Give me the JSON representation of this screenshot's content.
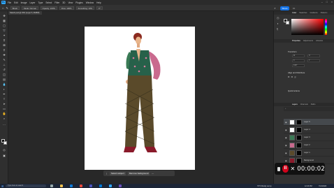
{
  "menubar": {
    "logo": "Ps",
    "items": [
      "File",
      "Edit",
      "Image",
      "Layer",
      "Type",
      "Select",
      "Filter",
      "3D",
      "View",
      "Plugins",
      "Window",
      "Help"
    ]
  },
  "options": {
    "brush_label": "Brush",
    "mode_label": "Mode: Normal",
    "opacity_label": "Opacity: 100%",
    "flow_label": "Flow: 100%",
    "smoothing_label": "Smoothing: 10%",
    "angle_value": "0°",
    "share_label": "Share"
  },
  "document": {
    "tab_title": "Sketch.psd @ 33% (Layer 5, RGB/8)"
  },
  "context_bar": {
    "select_subject": "Select subject",
    "remove_background": "Remove background"
  },
  "panels": {
    "color_tabs": [
      "Color",
      "Swatches",
      "Gradients",
      "Patterns"
    ],
    "properties_tabs": [
      "Properties",
      "Adjustments",
      "Libraries"
    ],
    "transform_title": "Transform",
    "align_title": "Align and Distribute",
    "quick_actions_title": "Quick Actions",
    "layers_tabs": [
      "Layers",
      "Channels",
      "Paths"
    ],
    "fields": {
      "w": "W",
      "h": "H",
      "x": "X",
      "y": "Y",
      "angle": "0.00°"
    }
  },
  "layers": [
    {
      "name": "Layer 5"
    },
    {
      "name": "Layer 4"
    },
    {
      "name": "Layer 3"
    },
    {
      "name": "Layer 2"
    },
    {
      "name": "Layer 1"
    },
    {
      "name": "Background"
    }
  ],
  "recorder": {
    "timer": "00:00:02"
  },
  "taskbar": {
    "search_placeholder": "Type here to search",
    "weather": "79°F Mostly sunny",
    "time": "12:43 PM",
    "date": "7/21/2023"
  },
  "colors": {
    "accent": "#1473e6",
    "record": "#d0021b",
    "color_picker_hue": "#ff0000"
  }
}
